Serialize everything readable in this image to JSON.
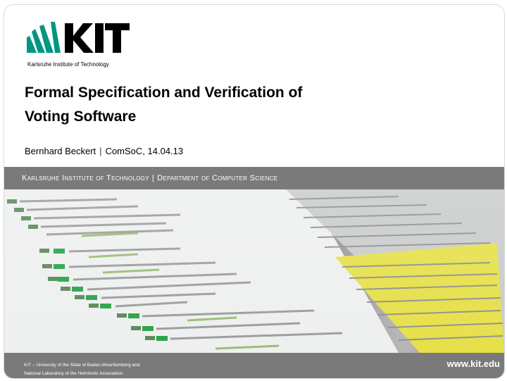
{
  "logo": {
    "wordmark": "KIT",
    "subtitle": "Karlsruhe Institute of Technology",
    "brand_color": "#009682"
  },
  "title": {
    "line1": "Formal Specification and Verification of",
    "line2": "Voting Software"
  },
  "author": {
    "name": "Bernhard Beckert",
    "separator": "|",
    "event": "ComSoC, 14.04.13"
  },
  "band": {
    "institute": "Karlsruhe Institute of Technology",
    "separator": "|",
    "department": "Department of Computer Science"
  },
  "footer": {
    "line1": "KIT – University of the State of Baden-Wuerttemberg and",
    "line2": "National Laboratory of the Helmholtz Association",
    "url": "www.kit.edu"
  },
  "colors": {
    "band": "#7a7a7a",
    "highlight": "#e6e04a",
    "node_green": "#2aa44a"
  }
}
